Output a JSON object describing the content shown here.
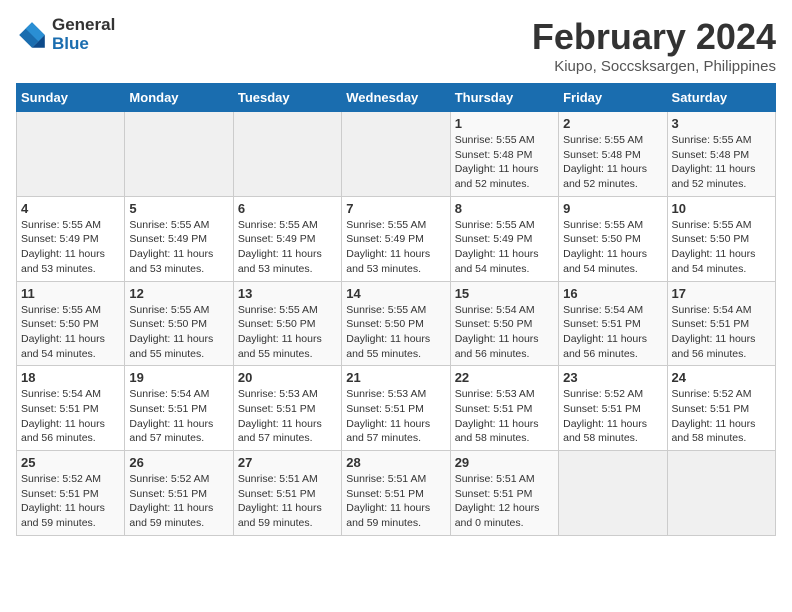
{
  "header": {
    "logo_line1": "General",
    "logo_line2": "Blue",
    "title": "February 2024",
    "subtitle": "Kiupo, Soccsksargen, Philippines"
  },
  "calendar": {
    "days_of_week": [
      "Sunday",
      "Monday",
      "Tuesday",
      "Wednesday",
      "Thursday",
      "Friday",
      "Saturday"
    ],
    "weeks": [
      [
        {
          "day": "",
          "info": ""
        },
        {
          "day": "",
          "info": ""
        },
        {
          "day": "",
          "info": ""
        },
        {
          "day": "",
          "info": ""
        },
        {
          "day": "1",
          "info": "Sunrise: 5:55 AM\nSunset: 5:48 PM\nDaylight: 11 hours\nand 52 minutes."
        },
        {
          "day": "2",
          "info": "Sunrise: 5:55 AM\nSunset: 5:48 PM\nDaylight: 11 hours\nand 52 minutes."
        },
        {
          "day": "3",
          "info": "Sunrise: 5:55 AM\nSunset: 5:48 PM\nDaylight: 11 hours\nand 52 minutes."
        }
      ],
      [
        {
          "day": "4",
          "info": "Sunrise: 5:55 AM\nSunset: 5:49 PM\nDaylight: 11 hours\nand 53 minutes."
        },
        {
          "day": "5",
          "info": "Sunrise: 5:55 AM\nSunset: 5:49 PM\nDaylight: 11 hours\nand 53 minutes."
        },
        {
          "day": "6",
          "info": "Sunrise: 5:55 AM\nSunset: 5:49 PM\nDaylight: 11 hours\nand 53 minutes."
        },
        {
          "day": "7",
          "info": "Sunrise: 5:55 AM\nSunset: 5:49 PM\nDaylight: 11 hours\nand 53 minutes."
        },
        {
          "day": "8",
          "info": "Sunrise: 5:55 AM\nSunset: 5:49 PM\nDaylight: 11 hours\nand 54 minutes."
        },
        {
          "day": "9",
          "info": "Sunrise: 5:55 AM\nSunset: 5:50 PM\nDaylight: 11 hours\nand 54 minutes."
        },
        {
          "day": "10",
          "info": "Sunrise: 5:55 AM\nSunset: 5:50 PM\nDaylight: 11 hours\nand 54 minutes."
        }
      ],
      [
        {
          "day": "11",
          "info": "Sunrise: 5:55 AM\nSunset: 5:50 PM\nDaylight: 11 hours\nand 54 minutes."
        },
        {
          "day": "12",
          "info": "Sunrise: 5:55 AM\nSunset: 5:50 PM\nDaylight: 11 hours\nand 55 minutes."
        },
        {
          "day": "13",
          "info": "Sunrise: 5:55 AM\nSunset: 5:50 PM\nDaylight: 11 hours\nand 55 minutes."
        },
        {
          "day": "14",
          "info": "Sunrise: 5:55 AM\nSunset: 5:50 PM\nDaylight: 11 hours\nand 55 minutes."
        },
        {
          "day": "15",
          "info": "Sunrise: 5:54 AM\nSunset: 5:50 PM\nDaylight: 11 hours\nand 56 minutes."
        },
        {
          "day": "16",
          "info": "Sunrise: 5:54 AM\nSunset: 5:51 PM\nDaylight: 11 hours\nand 56 minutes."
        },
        {
          "day": "17",
          "info": "Sunrise: 5:54 AM\nSunset: 5:51 PM\nDaylight: 11 hours\nand 56 minutes."
        }
      ],
      [
        {
          "day": "18",
          "info": "Sunrise: 5:54 AM\nSunset: 5:51 PM\nDaylight: 11 hours\nand 56 minutes."
        },
        {
          "day": "19",
          "info": "Sunrise: 5:54 AM\nSunset: 5:51 PM\nDaylight: 11 hours\nand 57 minutes."
        },
        {
          "day": "20",
          "info": "Sunrise: 5:53 AM\nSunset: 5:51 PM\nDaylight: 11 hours\nand 57 minutes."
        },
        {
          "day": "21",
          "info": "Sunrise: 5:53 AM\nSunset: 5:51 PM\nDaylight: 11 hours\nand 57 minutes."
        },
        {
          "day": "22",
          "info": "Sunrise: 5:53 AM\nSunset: 5:51 PM\nDaylight: 11 hours\nand 58 minutes."
        },
        {
          "day": "23",
          "info": "Sunrise: 5:52 AM\nSunset: 5:51 PM\nDaylight: 11 hours\nand 58 minutes."
        },
        {
          "day": "24",
          "info": "Sunrise: 5:52 AM\nSunset: 5:51 PM\nDaylight: 11 hours\nand 58 minutes."
        }
      ],
      [
        {
          "day": "25",
          "info": "Sunrise: 5:52 AM\nSunset: 5:51 PM\nDaylight: 11 hours\nand 59 minutes."
        },
        {
          "day": "26",
          "info": "Sunrise: 5:52 AM\nSunset: 5:51 PM\nDaylight: 11 hours\nand 59 minutes."
        },
        {
          "day": "27",
          "info": "Sunrise: 5:51 AM\nSunset: 5:51 PM\nDaylight: 11 hours\nand 59 minutes."
        },
        {
          "day": "28",
          "info": "Sunrise: 5:51 AM\nSunset: 5:51 PM\nDaylight: 11 hours\nand 59 minutes."
        },
        {
          "day": "29",
          "info": "Sunrise: 5:51 AM\nSunset: 5:51 PM\nDaylight: 12 hours\nand 0 minutes."
        },
        {
          "day": "",
          "info": ""
        },
        {
          "day": "",
          "info": ""
        }
      ]
    ]
  }
}
